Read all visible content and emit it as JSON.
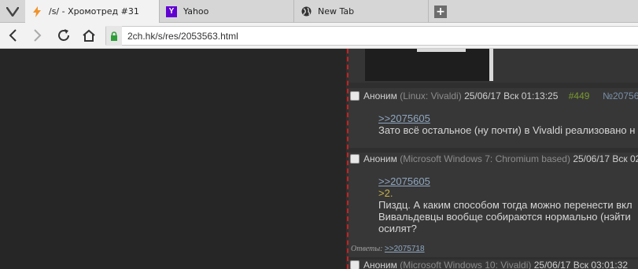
{
  "browser": {
    "tabs": [
      {
        "title": "/s/ - Хромотред #31",
        "icon": "vivaldi-bolt-icon",
        "active": true
      },
      {
        "title": "Yahoo",
        "icon": "yahoo-icon",
        "active": false
      },
      {
        "title": "New Tab",
        "icon": "globe-icon",
        "active": false
      }
    ],
    "new_tab_label": "+",
    "url": "2ch.hk/s/res/2053563.html"
  },
  "posts": [
    {
      "name": "Аноним",
      "client": "(Linux: Vivaldi)",
      "date": "25/06/17 Вск 01:13:25",
      "number": "#449",
      "id_link": "№20756",
      "lines": [
        ">>2075605",
        "Зато всё остальное (ну почти) в Vivaldi реализовано н"
      ]
    },
    {
      "name": "Аноним",
      "client": "(Microsoft Windows 7: Chromium based)",
      "date": "25/06/17 Вск 02",
      "lines": [
        ">>2075605",
        ">2.",
        "Пиздц. А каким способом тогда можно перенести вкл",
        "Вивальдевцы вообще собираются нормально (нэйти",
        "осилят?"
      ],
      "answers_label": "Ответы:",
      "answers_link": ">>2075718"
    },
    {
      "name": "Аноним",
      "client": "(Microsoft Windows 10: Vivaldi)",
      "date": "25/06/17 Вск 03:01:32"
    }
  ]
}
